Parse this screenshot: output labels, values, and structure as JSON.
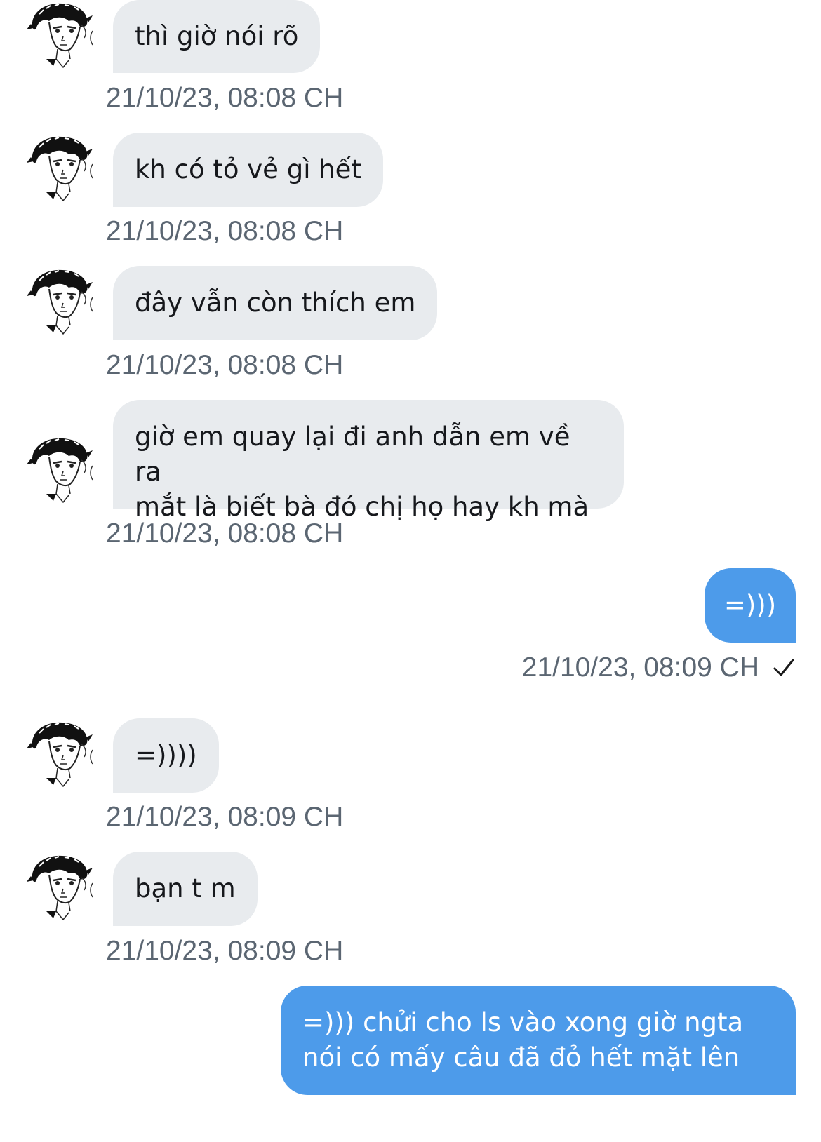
{
  "conversation": {
    "messages": [
      {
        "direction": "in",
        "text": "thì giờ nói rõ",
        "timestamp": "21/10/23, 08:08 CH"
      },
      {
        "direction": "in",
        "text": "kh có tỏ vẻ gì hết",
        "timestamp": "21/10/23, 08:08 CH"
      },
      {
        "direction": "in",
        "text": "đây vẫn còn thích em",
        "timestamp": "21/10/23, 08:08 CH"
      },
      {
        "direction": "in",
        "lines": [
          "giờ em quay lại đi anh dẫn em về ra",
          "mắt là biết bà đó chị họ hay kh mà"
        ],
        "timestamp": "21/10/23, 08:08 CH"
      },
      {
        "direction": "out",
        "text": "=)))",
        "timestamp": "21/10/23, 08:09 CH",
        "status_icon": "checkmark-icon"
      },
      {
        "direction": "in",
        "text": "=))))",
        "timestamp": "21/10/23, 08:09 CH"
      },
      {
        "direction": "in",
        "text": "bạn t m",
        "timestamp": "21/10/23, 08:09 CH"
      },
      {
        "direction": "out",
        "lines": [
          "=))) chửi cho ls vào xong giờ ngta",
          "nói có mấy câu đã đỏ hết mặt lên"
        ]
      }
    ]
  },
  "colors": {
    "incoming_bubble": "#e8ebee",
    "outgoing_bubble": "#4d9bea",
    "timestamp_text": "#5b6672"
  },
  "icons": {
    "avatar": "manga-character-avatar",
    "read_status": "checkmark-icon"
  }
}
